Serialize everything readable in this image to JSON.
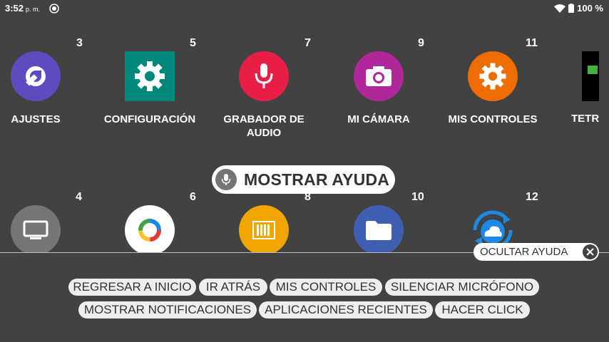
{
  "status_bar": {
    "time": "3:52",
    "ampm": "p. m.",
    "battery": "100 %"
  },
  "apps_top": [
    {
      "num": "3",
      "label": "AJUSTES",
      "color": "#5c4cc0",
      "icon": "wrench-icon"
    },
    {
      "num": "5",
      "label": "CONFIGURACIÓN",
      "color": "#00897b",
      "icon": "gear-icon"
    },
    {
      "num": "7",
      "label": "GRABADOR DE AUDIO",
      "color": "#e91e47",
      "icon": "microphone-icon"
    },
    {
      "num": "9",
      "label": "MI CÁMARA",
      "color": "#b0279a",
      "icon": "camera-icon"
    },
    {
      "num": "11",
      "label": "MIS CONTROLES",
      "color": "#ef6c00",
      "icon": "gear-icon"
    },
    {
      "num": "",
      "label": "TETR",
      "color": "#000000",
      "icon": "tetris-icon"
    }
  ],
  "apps_bottom": [
    {
      "num": "4",
      "color": "#757575",
      "icon": "tv-icon"
    },
    {
      "num": "6",
      "color": "#ffffff",
      "icon": "ring-icon"
    },
    {
      "num": "8",
      "color": "#f0a500",
      "icon": "barcode-icon"
    },
    {
      "num": "10",
      "color": "#3f5fb3",
      "icon": "folder-icon"
    },
    {
      "num": "12",
      "color": "#1e88e5",
      "icon": "cloud-sync-icon"
    }
  ],
  "help_pill": {
    "label": "MOSTRAR AYUDA"
  },
  "hide_help": {
    "label": "OCULTAR AYUDA"
  },
  "commands": {
    "row1": [
      "REGRESAR A INICIO",
      "IR ATRÁS",
      "MIS CONTROLES",
      "SILENCIAR MICRÓFONO"
    ],
    "row2": [
      "MOSTRAR NOTIFICACIONES",
      "APLICACIONES RECIENTES",
      "HACER CLICK"
    ]
  }
}
